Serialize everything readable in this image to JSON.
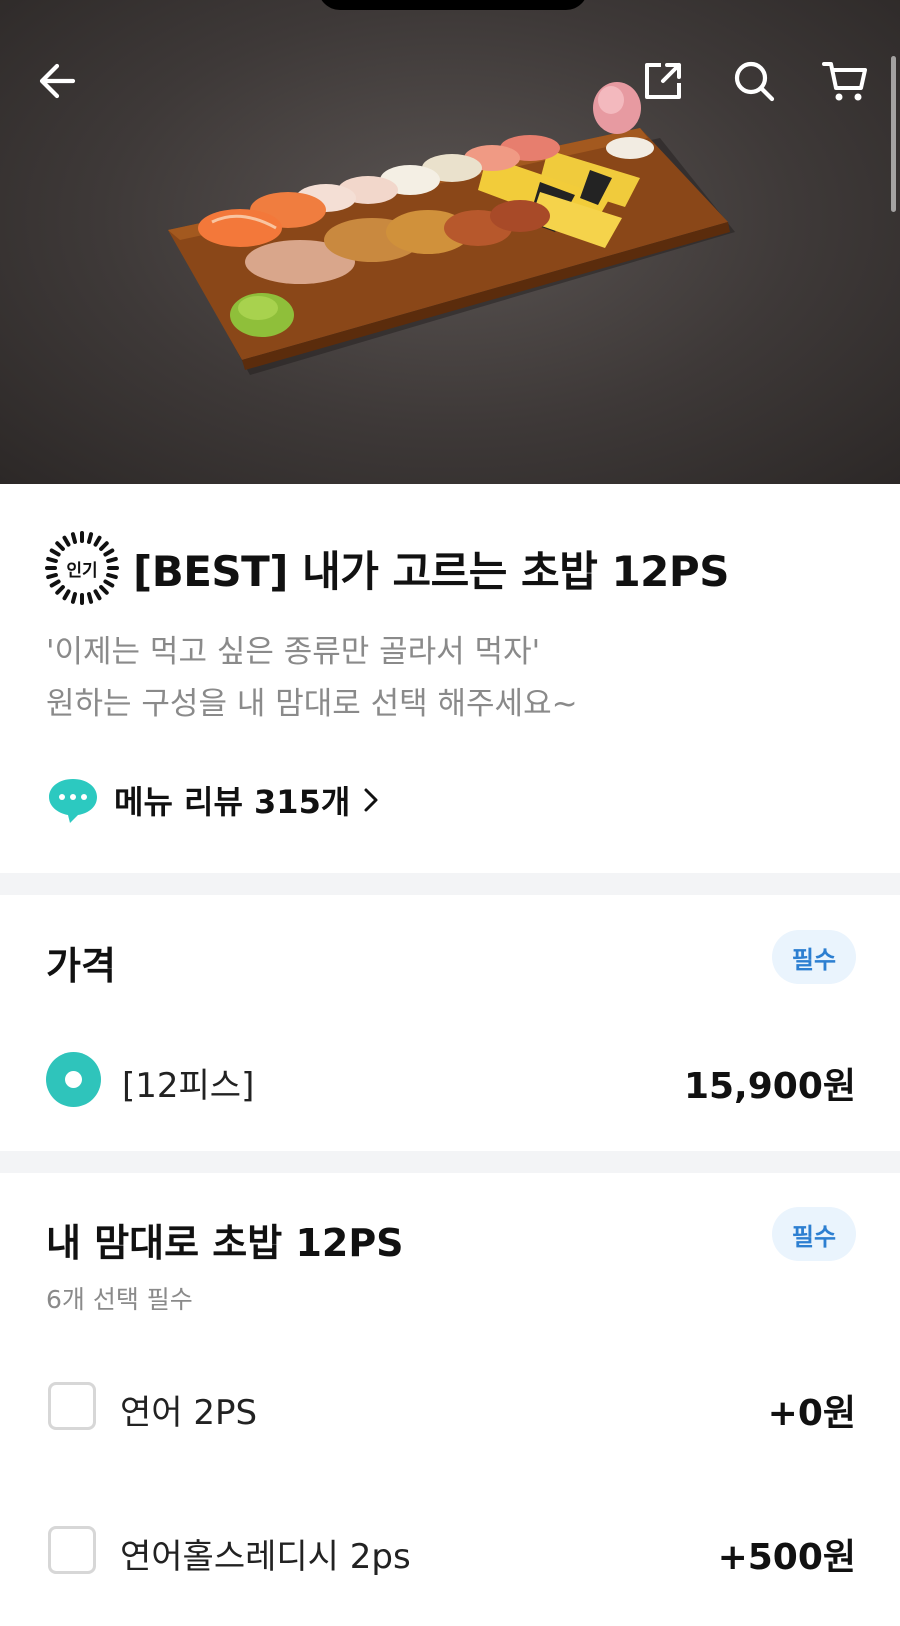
{
  "product": {
    "badge": "인기",
    "title": "[BEST] 내가 고르는 초밥 12PS",
    "description_lines": [
      "'이제는 먹고 싶은 종류만 골라서 먹자'",
      "원하는 구성을 내 맘대로 선택 해주세요~"
    ],
    "review_link": "메뉴 리뷰 315개"
  },
  "price_section": {
    "title": "가격",
    "required_label": "필수",
    "option": {
      "label": "[12피스]",
      "price": "15,900원",
      "selected": true
    }
  },
  "choice_section": {
    "title": "내 맘대로 초밥 12PS",
    "required_label": "필수",
    "subtitle": "6개 선택 필수",
    "options": [
      {
        "label": "연어 2PS",
        "price": "+0원",
        "checked": false
      },
      {
        "label": "연어홀스레디시 2ps",
        "price": "+500원",
        "checked": false
      }
    ]
  },
  "icons": {
    "back": "arrow-left-icon",
    "share": "share-icon",
    "search": "search-icon",
    "cart": "cart-icon",
    "review": "speech-bubble-icon",
    "chevron": "chevron-right-icon"
  },
  "colors": {
    "accent": "#2fc4bb",
    "required_pill_bg": "#eaf4fd",
    "required_pill_text": "#2d7fd1"
  }
}
